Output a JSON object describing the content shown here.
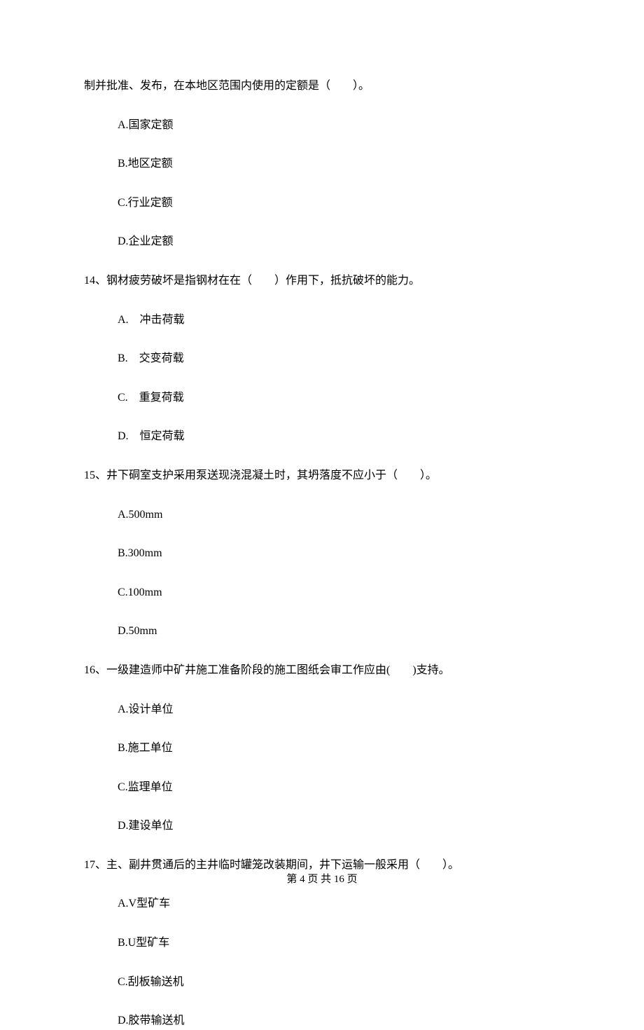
{
  "q13": {
    "stem_fragment": "制并批准、发布，在本地区范围内使用的定额是（　　）。",
    "options": {
      "A": "A.国家定额",
      "B": "B.地区定额",
      "C": "C.行业定额",
      "D": "D.企业定额"
    }
  },
  "q14": {
    "stem": "14、钢材疲劳破坏是指钢材在在（　　）作用下，抵抗破坏的能力。",
    "options": {
      "A": "A.　冲击荷载",
      "B": "B.　交变荷载",
      "C": "C.　重复荷载",
      "D": "D.　恒定荷载"
    }
  },
  "q15": {
    "stem": "15、井下硐室支护采用泵送现浇混凝土时，其坍落度不应小于（　　）。",
    "options": {
      "A": "A.500mm",
      "B": "B.300mm",
      "C": "C.100mm",
      "D": "D.50mm"
    }
  },
  "q16": {
    "stem": "16、一级建造师中矿井施工准备阶段的施工图纸会审工作应由(　　)支持。",
    "options": {
      "A": "A.设计单位",
      "B": "B.施工单位",
      "C": "C.监理单位",
      "D": "D.建设单位"
    }
  },
  "q17": {
    "stem": "17、主、副井贯通后的主井临时罐笼改装期间，井下运输一般采用（　　）。",
    "options": {
      "A": "A.V型矿车",
      "B": "B.U型矿车",
      "C": "C.刮板输送机",
      "D": "D.胶带输送机"
    }
  },
  "footer": "第 4 页 共 16 页"
}
